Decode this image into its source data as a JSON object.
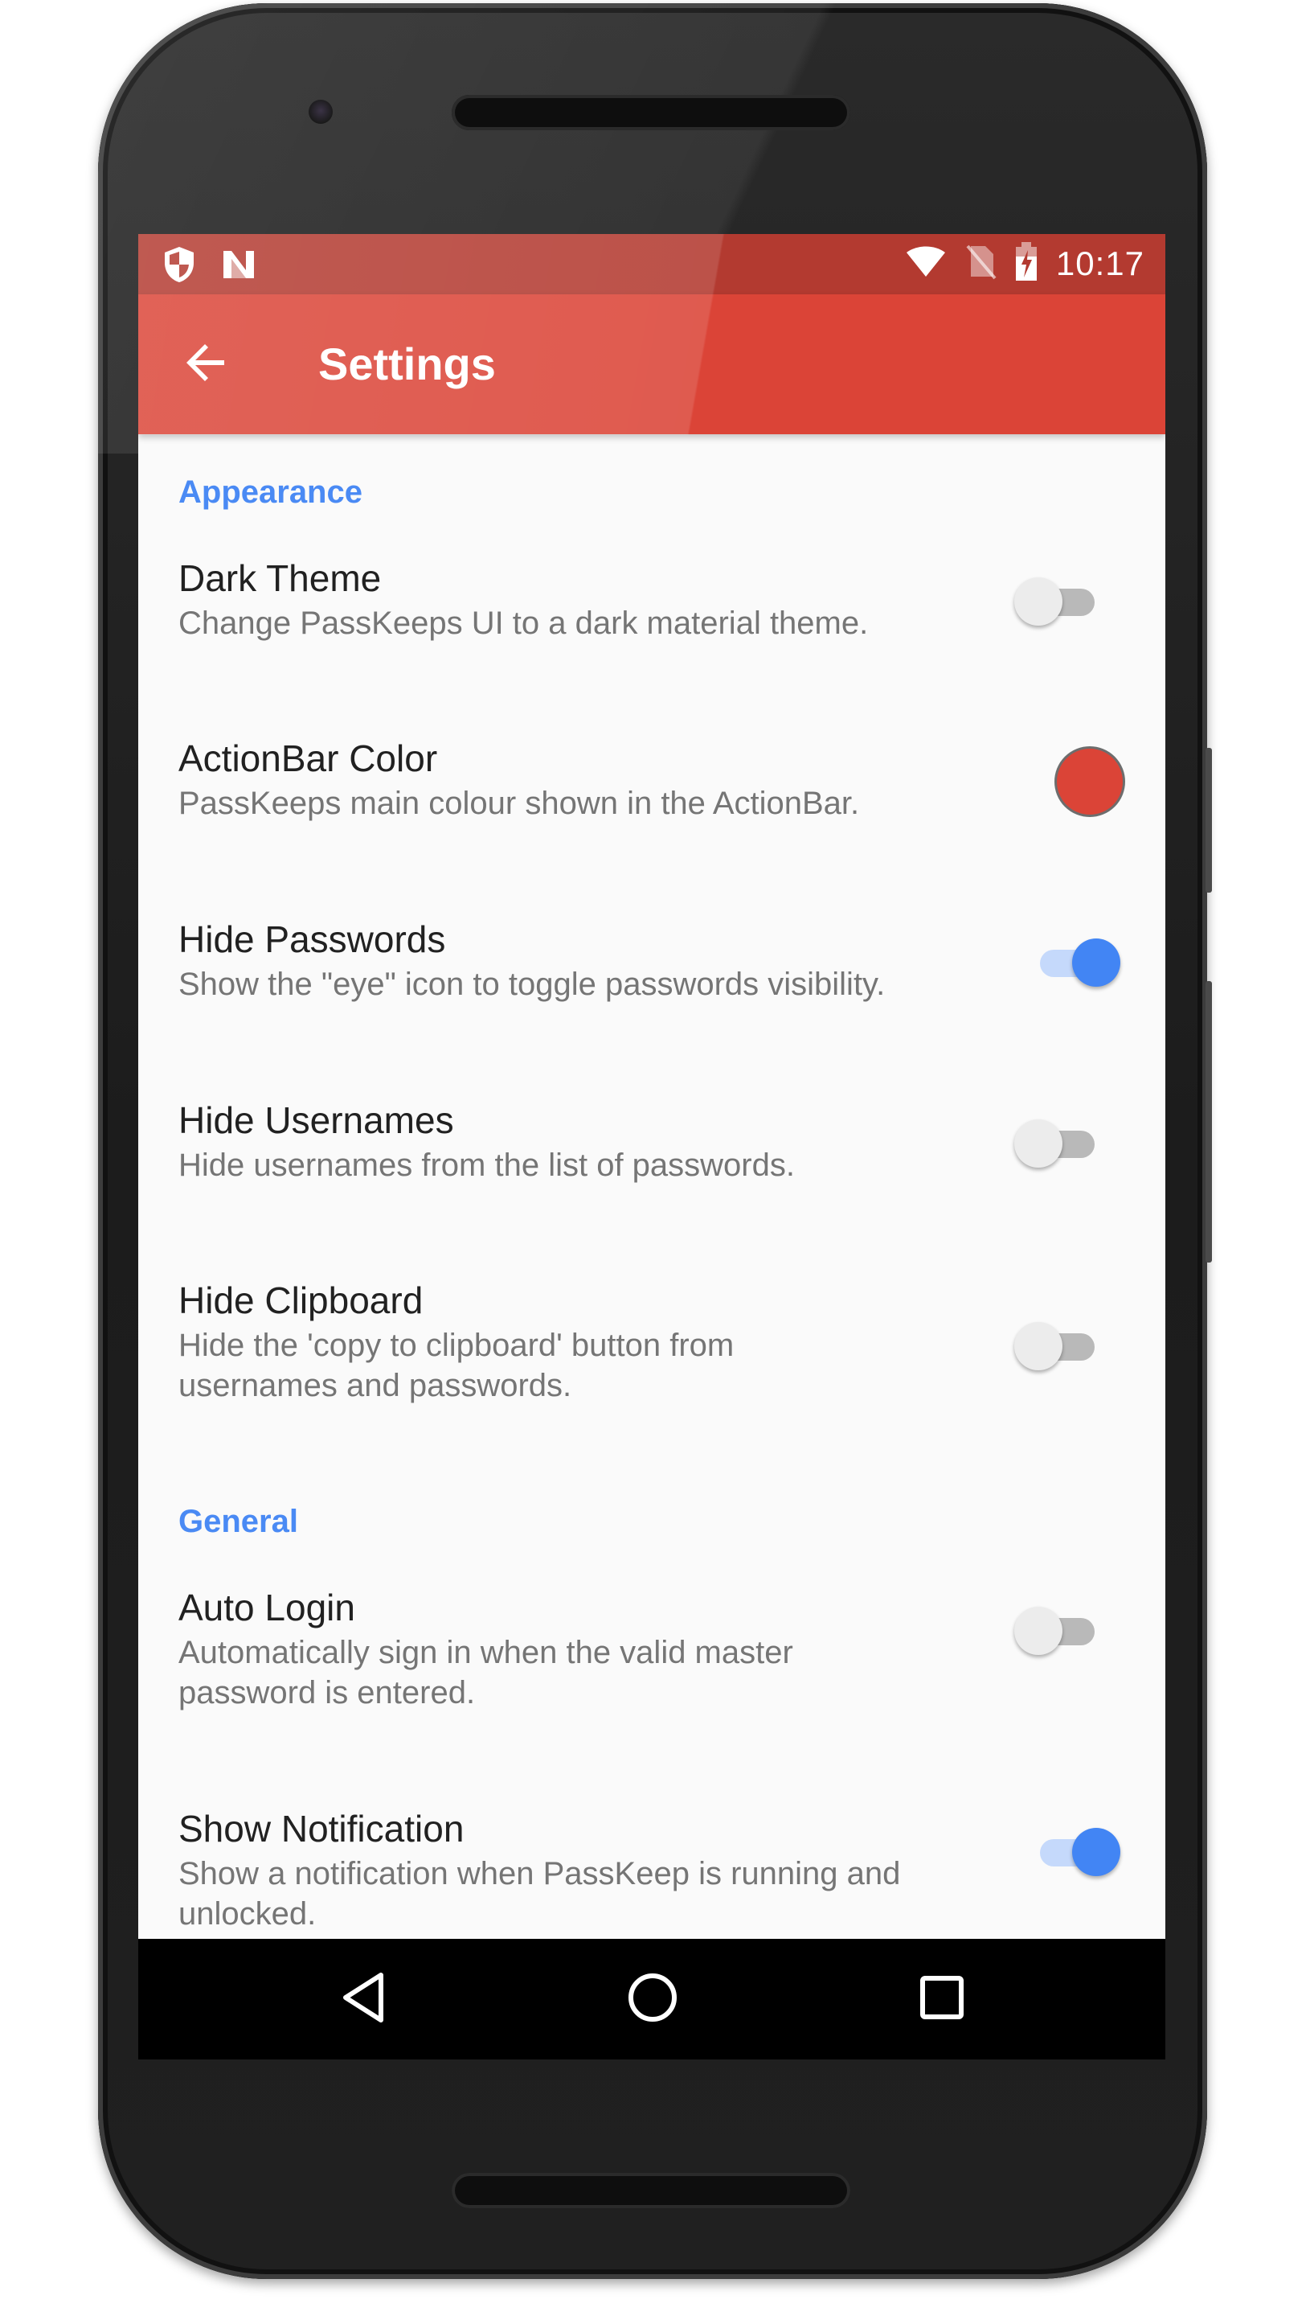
{
  "status_bar": {
    "left_icons": [
      "shield-icon",
      "n-notification-icon"
    ],
    "right_icons": [
      "wifi-icon",
      "no-sim-icon",
      "battery-charging-icon"
    ],
    "time": "10:17"
  },
  "action_bar": {
    "back_icon": "arrow-back-icon",
    "title": "Settings",
    "color": "#db4437"
  },
  "sections": [
    {
      "title": "Appearance",
      "items": [
        {
          "title": "Dark Theme",
          "summary": "Change PassKeeps UI to a dark material theme.",
          "control": "switch",
          "checked": false
        },
        {
          "title": "ActionBar Color",
          "summary": "PassKeeps main colour shown in the ActionBar.",
          "control": "color",
          "color": "#db4437"
        },
        {
          "title": "Hide Passwords",
          "summary": "Show the \"eye\" icon to toggle passwords visibility.",
          "control": "switch",
          "checked": true
        },
        {
          "title": "Hide Usernames",
          "summary": "Hide usernames from the list of passwords.",
          "control": "switch",
          "checked": false
        },
        {
          "title": "Hide Clipboard",
          "summary": "Hide the 'copy to clipboard' button from usernames and passwords.",
          "control": "switch",
          "checked": false
        }
      ]
    },
    {
      "title": "General",
      "items": [
        {
          "title": "Auto Login",
          "summary": "Automatically sign in when the valid master password is entered.",
          "control": "switch",
          "checked": false
        },
        {
          "title": "Show Notification",
          "summary": "Show a notification when PassKeep is running and unlocked.",
          "control": "switch",
          "checked": true
        }
      ]
    }
  ],
  "nav_bar": {
    "buttons": [
      "back-triangle-icon",
      "home-circle-icon",
      "recents-square-icon"
    ]
  },
  "colors": {
    "accent": "#4285f4",
    "primary": "#db4437",
    "primary_dark": "#b33a30"
  }
}
